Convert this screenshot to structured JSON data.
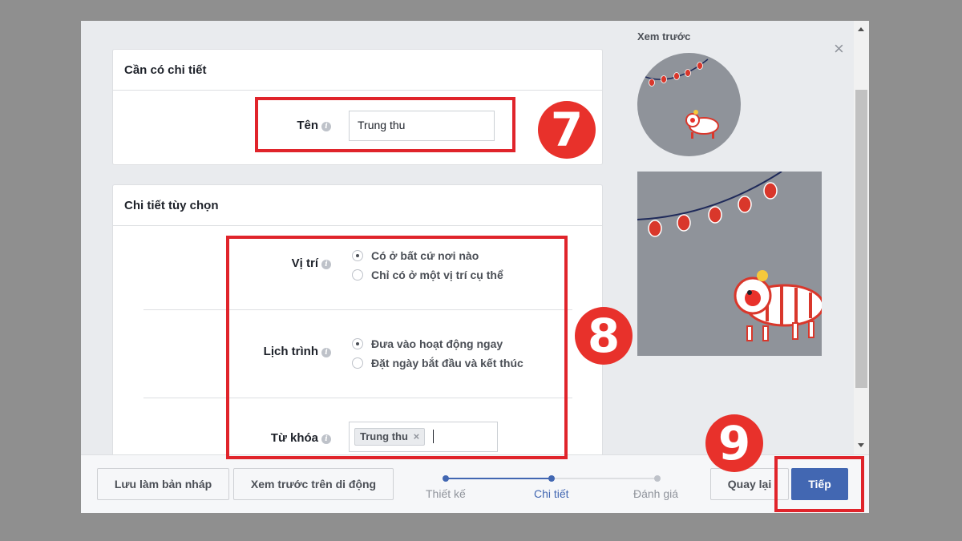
{
  "required_section": {
    "title": "Cần có chi tiết",
    "name_label": "Tên",
    "name_value": "Trung thu"
  },
  "optional_section": {
    "title": "Chi tiết tùy chọn",
    "location": {
      "label": "Vị trí",
      "options": [
        "Có ở bất cứ nơi nào",
        "Chỉ có ở một vị trí cụ thể"
      ],
      "selected": 0
    },
    "schedule": {
      "label": "Lịch trình",
      "options": [
        "Đưa vào hoạt động ngay",
        "Đặt ngày bắt đầu và kết thúc"
      ],
      "selected": 0
    },
    "keywords": {
      "label": "Từ khóa",
      "tags": [
        "Trung thu"
      ]
    }
  },
  "preview": {
    "title": "Xem trước",
    "close_icon": "close-icon"
  },
  "annotations": {
    "step7": "7",
    "step8": "8",
    "step9": "9",
    "highlight_color": "#e0242b"
  },
  "footer": {
    "save_draft_label": "Lưu làm bản nháp",
    "mobile_preview_label": "Xem trước trên di động",
    "steps": [
      "Thiết kế",
      "Chi tiết",
      "Đánh giá"
    ],
    "current_step": 1,
    "back_label": "Quay lại",
    "next_label": "Tiếp"
  },
  "colors": {
    "accent": "#4267b2",
    "preview_bg": "#8f939a",
    "lantern_red": "#d9372b"
  }
}
